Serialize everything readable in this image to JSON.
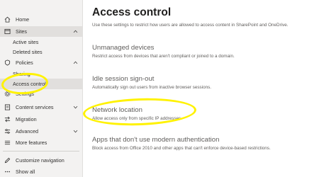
{
  "sidebar": {
    "items": [
      {
        "label": "Home",
        "icon": "home-icon"
      },
      {
        "label": "Sites",
        "icon": "sites-icon"
      },
      {
        "label": "Active sites"
      },
      {
        "label": "Deleted sites"
      },
      {
        "label": "Policies",
        "icon": "policies-icon"
      },
      {
        "label": "Sharing"
      },
      {
        "label": "Access control"
      },
      {
        "label": "Settings",
        "icon": "settings-icon"
      },
      {
        "label": "Content services",
        "icon": "content-services-icon"
      },
      {
        "label": "Migration",
        "icon": "migration-icon"
      },
      {
        "label": "Advanced",
        "icon": "advanced-icon"
      },
      {
        "label": "More features",
        "icon": "more-features-icon"
      },
      {
        "label": "Customize navigation",
        "icon": "pencil-icon"
      },
      {
        "label": "Show all",
        "icon": "ellipsis-icon"
      }
    ]
  },
  "main": {
    "title": "Access control",
    "description": "Use these settings to restrict how users are allowed to access content in SharePoint and OneDrive.",
    "sections": [
      {
        "title": "Unmanaged devices",
        "description": "Restrict access from devices that aren't compliant or joined to a domain."
      },
      {
        "title": "Idle session sign-out",
        "description": "Automatically sign out users from inactive browser sessions."
      },
      {
        "title": "Network location",
        "description": "Allow access only from specific IP addresses."
      },
      {
        "title": "Apps that don't use modern authentication",
        "description": "Block access from Office 2010 and other apps that can't enforce device-based restrictions."
      }
    ]
  },
  "colors": {
    "highlight": "#fff200",
    "sidebar_bg": "#f3f2f1",
    "selected_bg": "#e1dfdd"
  }
}
